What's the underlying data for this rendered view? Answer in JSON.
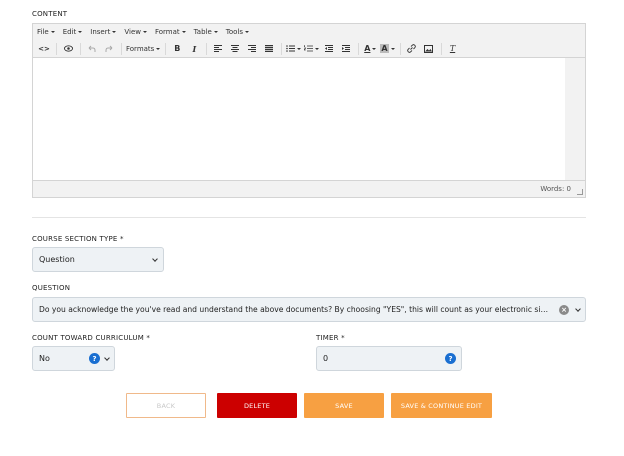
{
  "content": {
    "label": "CONTENT",
    "menubar": [
      {
        "label": "File"
      },
      {
        "label": "Edit"
      },
      {
        "label": "Insert"
      },
      {
        "label": "View"
      },
      {
        "label": "Format"
      },
      {
        "label": "Table"
      },
      {
        "label": "Tools"
      }
    ],
    "toolbar": {
      "source_icon": "<>",
      "formats_label": "Formats",
      "bold_label": "B",
      "italic_label": "I",
      "text_color_label": "A",
      "bg_color_label": "A",
      "clear_format_label": "T"
    },
    "word_count": "Words: 0"
  },
  "course_section_type": {
    "label": "COURSE SECTION TYPE *",
    "value": "Question"
  },
  "question": {
    "label": "QUESTION",
    "value": "Do you acknowledge the you've read and understand the above documents? By choosing \"YES\", this will count as your electronic signat..."
  },
  "count_toward_curriculum": {
    "label": "COUNT TOWARD CURRICULUM *",
    "value": "No",
    "help": "?"
  },
  "timer": {
    "label": "TIMER *",
    "value": "0",
    "help": "?"
  },
  "actions": {
    "back": "BACK",
    "delete": "DELETE",
    "save": "SAVE",
    "save_continue": "SAVE & CONTINUE EDIT"
  },
  "colors": {
    "delete": "#cc0000",
    "save": "#f7a042",
    "help": "#1a6fd1",
    "field_bg": "#eef2f5"
  }
}
